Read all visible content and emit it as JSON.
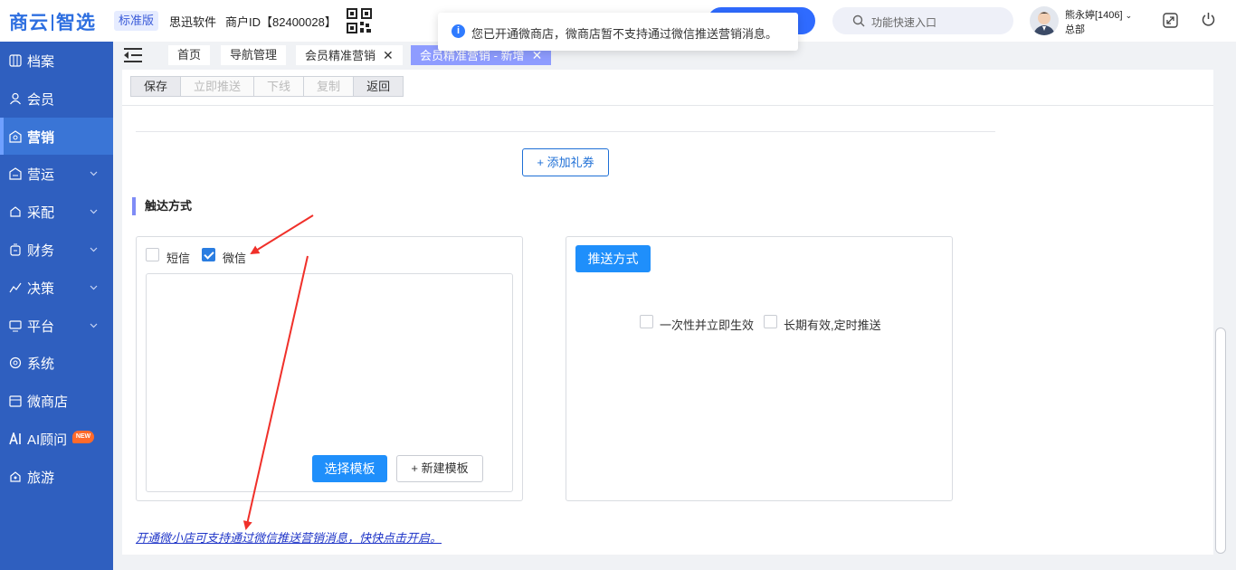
{
  "header": {
    "logo_part1": "商云",
    "logo_part2": "智选",
    "edition": "标准版",
    "company": "思迅软件",
    "merchant_id": "商户ID【82400028】",
    "search_placeholder": "功能快速入口",
    "user_name": "熊永婷[1406]",
    "user_dept": "总部"
  },
  "toast": {
    "message": "您已开通微商店，微商店暂不支持通过微信推送营销消息。"
  },
  "sidebar": {
    "items": [
      {
        "label": "档案",
        "icon": "archive-icon"
      },
      {
        "label": "会员",
        "icon": "user-icon"
      },
      {
        "label": "营销",
        "icon": "marketing-icon",
        "active": true
      },
      {
        "label": "营运",
        "icon": "operations-icon"
      },
      {
        "label": "采配",
        "icon": "purchase-icon"
      },
      {
        "label": "财务",
        "icon": "finance-icon"
      },
      {
        "label": "决策",
        "icon": "decision-icon"
      },
      {
        "label": "平台",
        "icon": "platform-icon"
      },
      {
        "label": "系统",
        "icon": "system-icon"
      },
      {
        "label": "微商店",
        "icon": "store-icon"
      },
      {
        "label": "AI顾问",
        "icon": "ai-icon",
        "badge": "NEW"
      },
      {
        "label": "旅游",
        "icon": "travel-icon"
      }
    ]
  },
  "tabs": [
    {
      "label": "首页"
    },
    {
      "label": "导航管理"
    },
    {
      "label": "会员精准营销"
    },
    {
      "label": "会员精准营销 - 新增"
    }
  ],
  "toolbar": {
    "save": "保存",
    "push_now": "立即推送",
    "offline": "下线",
    "copy": "复制",
    "back": "返回"
  },
  "content": {
    "add_coupon": "+ 添加礼券",
    "section_title": "触达方式",
    "sms_label": "短信",
    "wechat_label": "微信",
    "select_template": "选择模板",
    "new_template": "+ 新建模板",
    "push_method": "推送方式",
    "once_effective": "一次性并立即生效",
    "long_term": "长期有效,定时推送",
    "bottom_link": "开通微小店可支持通过微信推送营销消息，快快点击开启。"
  },
  "colors": {
    "sidebar_bg": "#2f5fbf",
    "primary": "#1f8ffb",
    "active_tab": "#8e9cff",
    "annotation_arrow": "#f0302a"
  }
}
